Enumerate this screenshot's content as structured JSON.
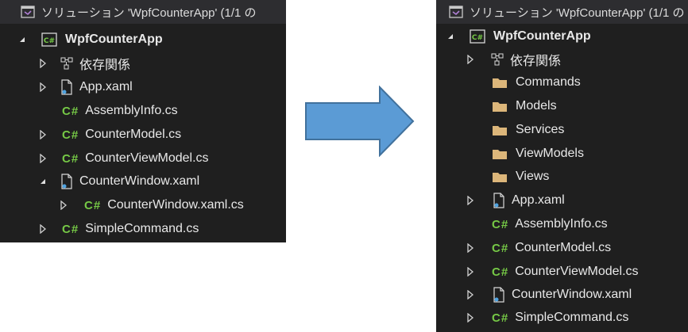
{
  "header_text": "ソリューション 'WpfCounterApp' (1/1 の",
  "before": {
    "project": "WpfCounterApp",
    "items": [
      {
        "label": "依存関係"
      },
      {
        "label": "App.xaml"
      },
      {
        "label": "AssemblyInfo.cs"
      },
      {
        "label": "CounterModel.cs"
      },
      {
        "label": "CounterViewModel.cs"
      },
      {
        "label": "CounterWindow.xaml"
      },
      {
        "label": "CounterWindow.xaml.cs"
      },
      {
        "label": "SimpleCommand.cs"
      }
    ]
  },
  "after": {
    "project": "WpfCounterApp",
    "items": [
      {
        "label": "依存関係"
      },
      {
        "label": "Commands"
      },
      {
        "label": "Models"
      },
      {
        "label": "Services"
      },
      {
        "label": "ViewModels"
      },
      {
        "label": "Views"
      },
      {
        "label": "App.xaml"
      },
      {
        "label": "AssemblyInfo.cs"
      },
      {
        "label": "CounterModel.cs"
      },
      {
        "label": "CounterViewModel.cs"
      },
      {
        "label": "CounterWindow.xaml"
      },
      {
        "label": "SimpleCommand.cs"
      }
    ]
  },
  "icons": {
    "cs_glyph": "C#",
    "project_glyph": "C#",
    "solution_icon": "visual-studio-solution-icon",
    "dependency_icon": "dependencies-icon",
    "folder_icon": "folder-icon",
    "xaml_icon": "xaml-file-icon",
    "collapsed_arrow": "chevron-right-outline-icon",
    "expanded_arrow": "triangle-down-icon",
    "transition_arrow": "right-arrow-icon"
  },
  "colors": {
    "panel_bg": "#1f1f1f",
    "header_bg": "#2d2d30",
    "text": "#e8e8e8",
    "cs_green": "#76c946",
    "folder": "#dcb67a",
    "arrow_fill": "#5b9bd5",
    "arrow_stroke": "#41719c"
  }
}
